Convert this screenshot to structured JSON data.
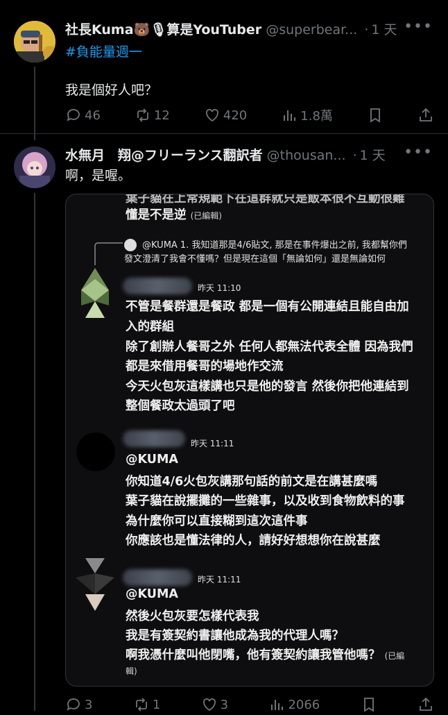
{
  "tweet1": {
    "name": "社長Kuma🐻🎙算是YouTuber",
    "handle": "@superbear...",
    "dot": "·",
    "time": "1 天",
    "hashtag": "#負能量週一",
    "text": "我是個好人吧？",
    "replies": "46",
    "retweets": "12",
    "likes": "420",
    "views": "1.8萬"
  },
  "tweet2": {
    "name": "水無月　翔@フリーランス翻訳者",
    "handle": "@thousan...",
    "dot": "·",
    "time": "1 天",
    "text": "啊，是喔。",
    "replies": "3",
    "retweets": "1",
    "likes": "3",
    "views": "2066"
  },
  "embed": {
    "top_line1": "葉子貓在上常規範下在這群就只是飯本很不互動很難",
    "top_line2": "懂是不是逆",
    "edited": "(已編輯)",
    "quote_line1": "@KUMA 1. 我知道那是4/6貼文, 那是在事件爆出之前, 我都幫你們",
    "quote_line2": "發文澄清了我會不懂嗎？但是現在這個「無論如何」還是無論如何",
    "msg1_time": "昨天 11:10",
    "msg1_lines": [
      "不管是餐群還是餐政 都是一個有公開連結且能自由加",
      "入的群組",
      "除了創辦人餐哥之外 任何人都無法代表全體 因為我們",
      "都是來借用餐哥的場地作交流",
      "今天火包灰這樣講也只是他的發言 然後你把他連結到",
      "整個餐政太過頭了吧"
    ],
    "msg2_time": "昨天 11:11",
    "msg2_lines": [
      "@KUMA",
      "你知道4/6火包灰講那句話的前文是在講甚麼嗎",
      "葉子貓在說擺攤的一些雜事，以及收到食物飲料的事",
      "為什麼你可以直接糊到這次這件事",
      "你應該也是懂法律的人，請好好想想你在說甚麼"
    ],
    "msg3_time": "昨天 11:11",
    "msg3_lines": [
      "@KUMA",
      "然後火包灰要怎樣代表我",
      "我是有簽契約書讓他成為我的代理人嗎？",
      "啊我憑什麼叫他閉嘴，他有簽契約讓我管他嗎？"
    ],
    "msg3_edited": "(已編",
    "msg3_edited2": "輯)"
  }
}
